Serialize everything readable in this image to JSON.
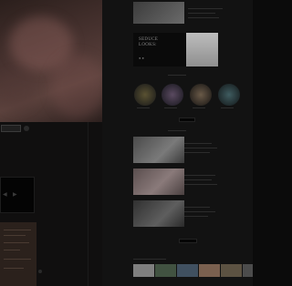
{
  "hero": {},
  "shop": {},
  "promo": {
    "title_line1": "SEDUCE",
    "title_line2": "LOOKS:",
    "title_line3": "",
    "photo_color": "#a9a9a9"
  },
  "categories": {
    "items": [
      {
        "label": "",
        "color": "#6e6236"
      },
      {
        "label": "",
        "color": "#6a5570"
      },
      {
        "label": "",
        "color": "#7a6a52"
      },
      {
        "label": "",
        "color": "#4f6f72"
      }
    ]
  },
  "blog": {
    "posts": [
      {
        "color": "#6b6b6b"
      },
      {
        "color": "#7a6a6a"
      },
      {
        "color": "#505050"
      }
    ]
  },
  "instagram": {
    "tiles": [
      {
        "color": "#8f8f8f"
      },
      {
        "color": "#4f5f4f"
      },
      {
        "color": "#4f6070"
      },
      {
        "color": "#8a7060"
      },
      {
        "color": "#6a6050"
      },
      {
        "color": "#5a5a5a"
      }
    ]
  }
}
